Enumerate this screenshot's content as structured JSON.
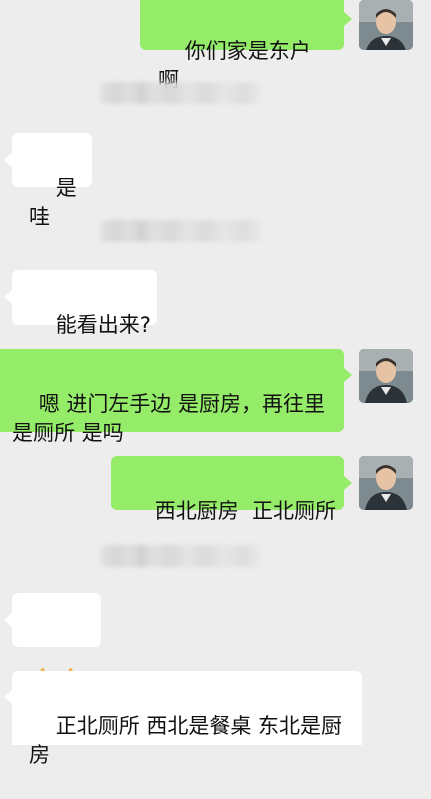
{
  "messages": [
    {
      "side": "right",
      "text": "你们家是东户啊"
    },
    {
      "side": "left",
      "text": "是哇"
    },
    {
      "side": "left",
      "text": "能看出来?"
    },
    {
      "side": "right",
      "text": "嗯 进门左手边 是厨房，再往里\n是厕所 是吗"
    },
    {
      "side": "right",
      "text": "西北厨房  正北厕所"
    },
    {
      "side": "left",
      "emoji": [
        "thumbs-up",
        "thumbs-up"
      ]
    },
    {
      "side": "left",
      "text": "正北厕所 西北是餐桌 东北是厨\n房"
    }
  ]
}
